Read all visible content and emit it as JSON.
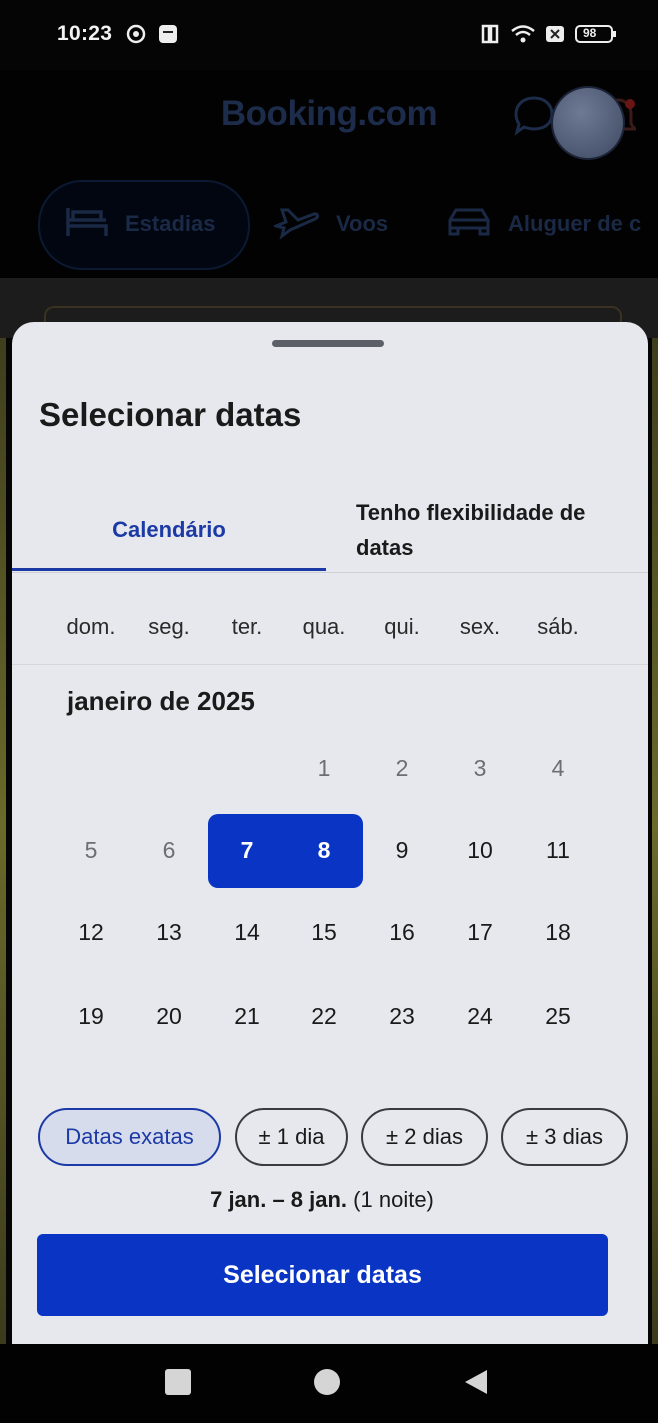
{
  "status_bar": {
    "time": "10:23",
    "battery": "98",
    "icons": [
      "vpn-icon",
      "notification-icon",
      "nfc-icon",
      "wifi-icon",
      "sim-icon",
      "battery-icon"
    ]
  },
  "background_app": {
    "brand": "Booking.com",
    "nav": [
      {
        "label": "Estadias",
        "icon": "bed-icon"
      },
      {
        "label": "Voos",
        "icon": "plane-icon"
      },
      {
        "label": "Aluguer de c",
        "icon": "car-icon"
      }
    ]
  },
  "sheet": {
    "title": "Selecionar datas",
    "tabs": {
      "calendar": "Calendário",
      "flexible_line1": "Tenho flexibilidade de",
      "flexible_line2": "datas"
    },
    "weekdays": [
      "dom.",
      "seg.",
      "ter.",
      "qua.",
      "qui.",
      "sex.",
      "sáb."
    ],
    "month_label": "janeiro de 2025",
    "calendar": {
      "selected_start": 7,
      "selected_end": 8,
      "weeks": [
        [
          "",
          "",
          "",
          "1",
          "2",
          "3",
          "4"
        ],
        [
          "5",
          "6",
          "7",
          "8",
          "9",
          "10",
          "11"
        ],
        [
          "12",
          "13",
          "14",
          "15",
          "16",
          "17",
          "18"
        ],
        [
          "19",
          "20",
          "21",
          "22",
          "23",
          "24",
          "25"
        ]
      ]
    },
    "chips": [
      "Datas exatas",
      "± 1 dia",
      "± 2 dias",
      "± 3 dias"
    ],
    "active_chip": "Datas exatas",
    "summary_range": "7 jan. – 8 jan.",
    "summary_nights": "(1 noite)",
    "cta": "Selecionar datas"
  },
  "colors": {
    "accent": "#0a35c4",
    "tab_active": "#1b3aa6",
    "sheet_bg": "#e7e8ed"
  }
}
